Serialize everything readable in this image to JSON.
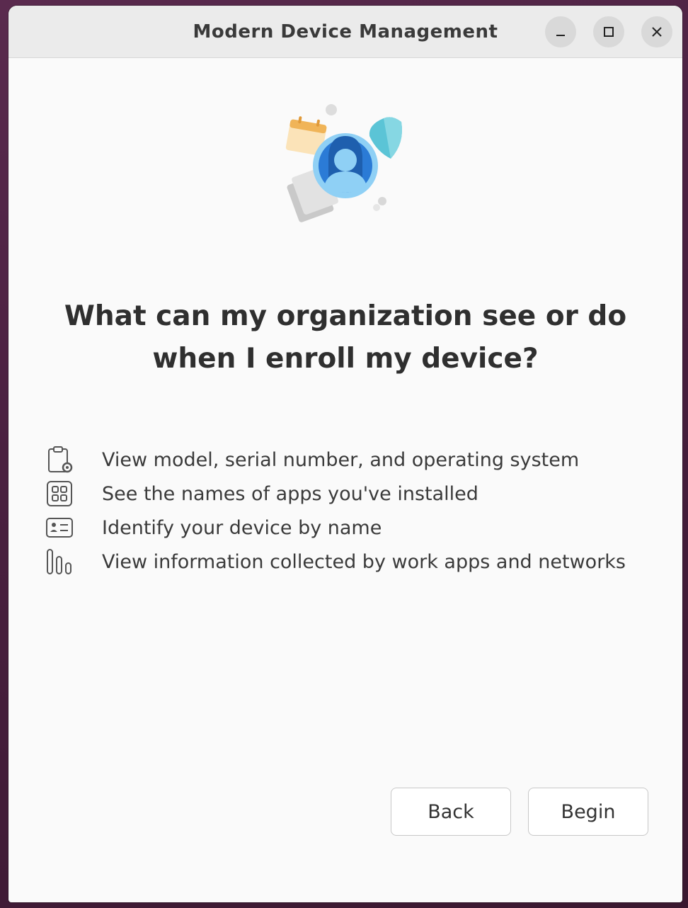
{
  "window": {
    "title": "Modern Device Management"
  },
  "main": {
    "heading_line1": "What can my organization see or do",
    "heading_line2": "when I enroll my device?",
    "items": [
      {
        "icon": "clipboard-gear-icon",
        "label": "View model, serial number, and operating system"
      },
      {
        "icon": "apps-grid-icon",
        "label": "See the names of apps you've installed"
      },
      {
        "icon": "id-card-icon",
        "label": "Identify your device by name"
      },
      {
        "icon": "bar-chart-icon",
        "label": "View information collected by work apps and networks"
      }
    ]
  },
  "footer": {
    "back_label": "Back",
    "begin_label": "Begin"
  },
  "colors": {
    "accent_blue": "#2b7bd6",
    "shield_teal": "#5bc4d6",
    "calendar_orange": "#f0b458"
  }
}
